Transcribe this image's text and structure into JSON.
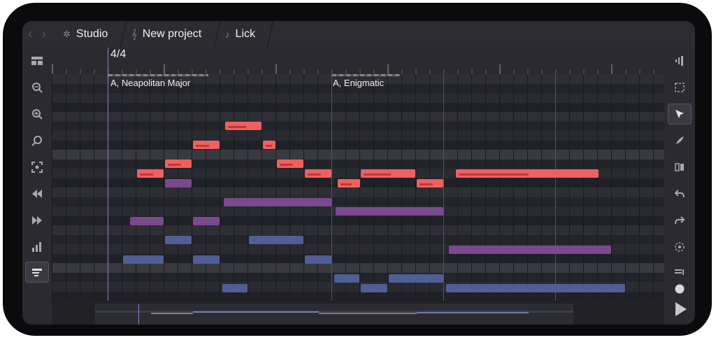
{
  "breadcrumb": [
    {
      "label": "Studio",
      "icon": "gear-icon"
    },
    {
      "label": "New project",
      "icon": "treble-clef-icon"
    },
    {
      "label": "Lick",
      "icon": "music-note-icon"
    }
  ],
  "timeline": {
    "time_signature": "4/4"
  },
  "scales": [
    {
      "label": "A, Neapolitan Major"
    },
    {
      "label": "A, Enigmatic"
    }
  ],
  "left_toolbar": [
    "layout-icon",
    "zoom-out-icon",
    "zoom-in-icon",
    "zoom-fit-icon",
    "focus-icon",
    "rewind-icon",
    "fast-forward-icon",
    "velocity-icon",
    "chords-icon"
  ],
  "right_toolbar": [
    "track-icon",
    "select-region-icon",
    "pointer-icon",
    "pen-icon",
    "split-icon",
    "undo-icon",
    "redo-icon",
    "snap-icon",
    "list-icon",
    "record-icon",
    "play-icon"
  ],
  "colors": {
    "note_red": "#f06060",
    "note_purple": "#7a4a8e",
    "note_blue": "#4f5f96",
    "accent": "#c25858"
  }
}
